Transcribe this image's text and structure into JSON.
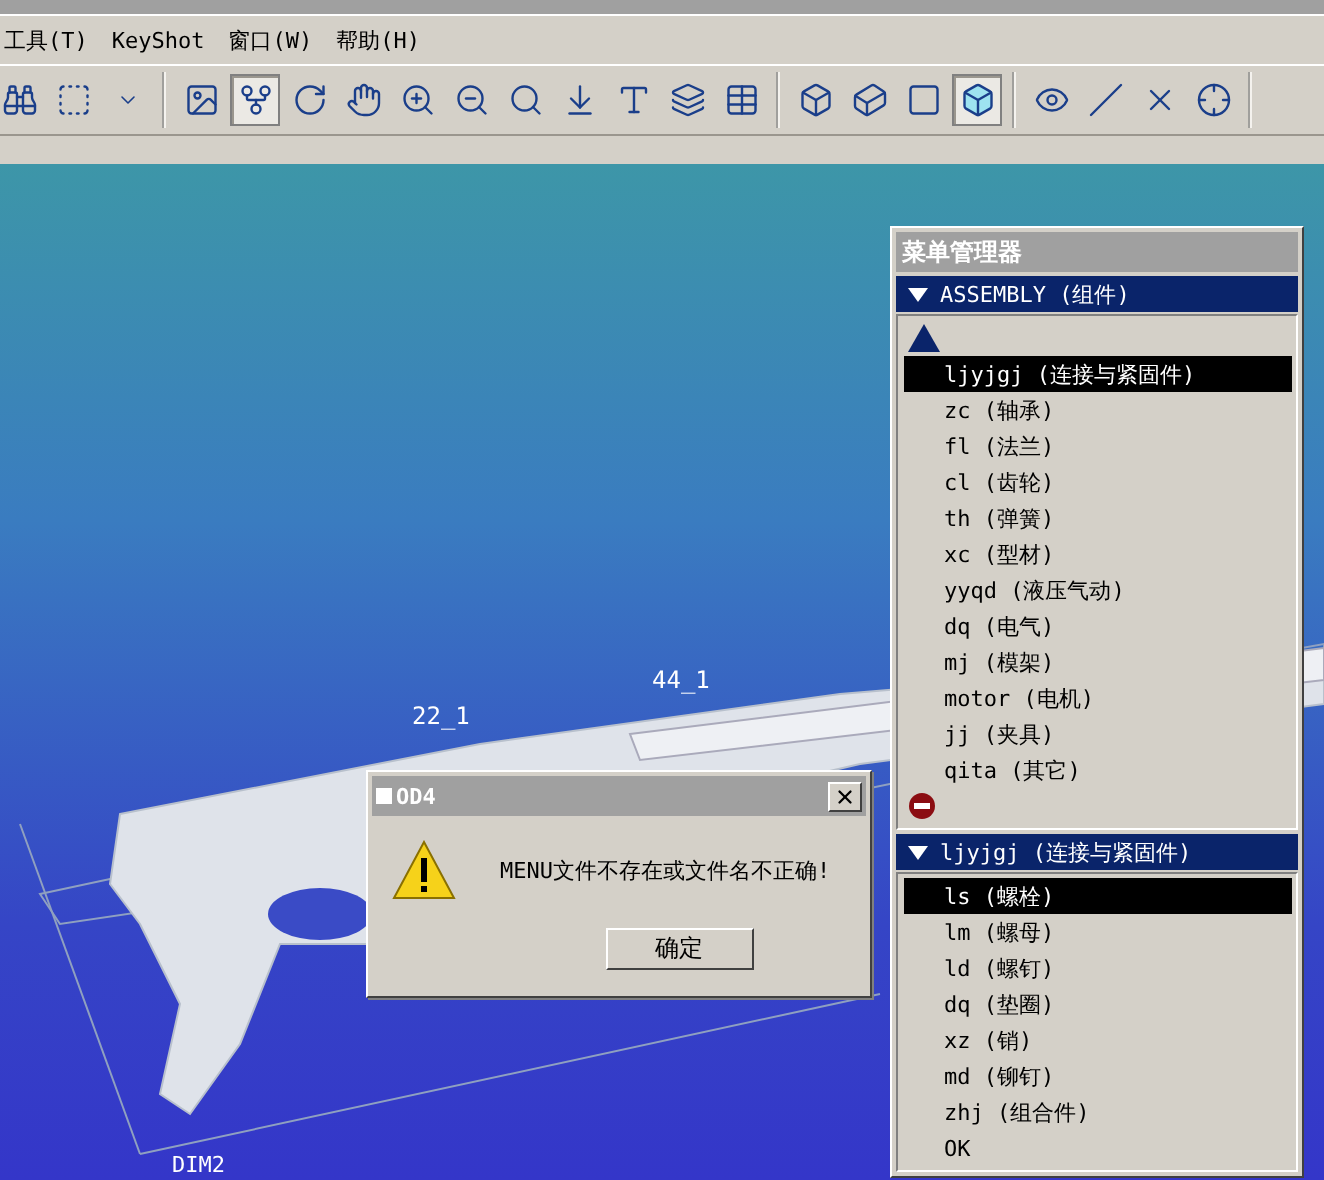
{
  "menu_bar": [
    "工具(T)",
    "KeyShot",
    "窗口(W)",
    "帮助(H)"
  ],
  "toolbar": {
    "groups": [
      [
        {
          "kind": "binoculars",
          "selected": false
        },
        {
          "kind": "select-box",
          "selected": false
        },
        {
          "kind": "caret",
          "selected": false
        }
      ],
      [
        {
          "kind": "view",
          "selected": false
        },
        {
          "kind": "spin-center",
          "selected": true
        },
        {
          "kind": "orient",
          "selected": false
        },
        {
          "kind": "pan",
          "selected": false
        },
        {
          "kind": "zoom-in",
          "selected": false
        },
        {
          "kind": "zoom-out",
          "selected": false
        },
        {
          "kind": "zoom-fit",
          "selected": false
        },
        {
          "kind": "import",
          "selected": false
        },
        {
          "kind": "annotate",
          "selected": false
        },
        {
          "kind": "layers",
          "selected": false
        },
        {
          "kind": "table",
          "selected": false
        }
      ],
      [
        {
          "kind": "wireframe",
          "selected": false
        },
        {
          "kind": "hidden-line",
          "selected": false
        },
        {
          "kind": "no-hidden",
          "selected": false
        },
        {
          "kind": "shaded",
          "selected": true
        }
      ],
      [
        {
          "kind": "plane",
          "selected": false
        },
        {
          "kind": "axis",
          "selected": false
        },
        {
          "kind": "point",
          "selected": false
        },
        {
          "kind": "csys",
          "selected": false
        }
      ]
    ]
  },
  "viewport": {
    "dimension_labels": [
      "22_1",
      "44_1",
      "DIM2"
    ]
  },
  "dialog": {
    "title": "OD4",
    "message": "MENU文件不存在或文件名不正确!",
    "button": "确定"
  },
  "menu_manager": {
    "title": "菜单管理器",
    "sections": [
      {
        "header": "ASSEMBLY (组件)",
        "top_arrow": true,
        "stop_icon": true,
        "items": [
          {
            "label": "ljyjgj (连接与紧固件)",
            "selected": true
          },
          {
            "label": "zc (轴承)",
            "selected": false
          },
          {
            "label": "fl (法兰)",
            "selected": false
          },
          {
            "label": "cl (齿轮)",
            "selected": false
          },
          {
            "label": "th (弹簧)",
            "selected": false
          },
          {
            "label": "xc (型材)",
            "selected": false
          },
          {
            "label": "yyqd (液压气动)",
            "selected": false
          },
          {
            "label": "dq (电气)",
            "selected": false
          },
          {
            "label": "mj (模架)",
            "selected": false
          },
          {
            "label": "motor (电机)",
            "selected": false
          },
          {
            "label": "jj (夹具)",
            "selected": false
          },
          {
            "label": "qita (其它)",
            "selected": false
          }
        ]
      },
      {
        "header": "ljyjgj (连接与紧固件)",
        "items": [
          {
            "label": "ls (螺栓)",
            "selected": true
          },
          {
            "label": "lm (螺母)",
            "selected": false
          },
          {
            "label": "ld (螺钉)",
            "selected": false
          },
          {
            "label": "dq (垫圈)",
            "selected": false
          },
          {
            "label": "xz (销)",
            "selected": false
          },
          {
            "label": "md (铆钉)",
            "selected": false
          },
          {
            "label": "zhj (组合件)",
            "selected": false
          },
          {
            "label": "OK",
            "selected": false
          }
        ]
      }
    ]
  }
}
